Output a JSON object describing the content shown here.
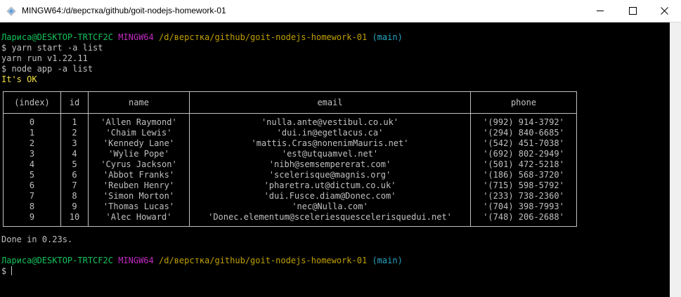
{
  "window": {
    "title": "MINGW64:/d/верстка/github/goit-nodejs-homework-01",
    "controls": {
      "minimize": "minimize",
      "maximize": "maximize",
      "close": "close"
    }
  },
  "prompt": {
    "user": "Лариса@DESKTOP-TRTCF2C",
    "msystem": "MINGW64",
    "path": "/d/верстка/github/goit-nodejs-homework-01",
    "branch": "(main)"
  },
  "output": {
    "line1": "$ yarn start -a list",
    "line2": "yarn run v1.22.11",
    "line3": "$ node app -a list",
    "line4": "It's OK",
    "done": "Done in 0.23s.",
    "final_prompt": "$"
  },
  "table": {
    "headers": [
      "(index)",
      "id",
      "name",
      "email",
      "phone"
    ],
    "rows": [
      [
        "0",
        "1",
        "'Allen Raymond'",
        "'nulla.ante@vestibul.co.uk'",
        "'(992) 914-3792'"
      ],
      [
        "1",
        "2",
        "'Chaim Lewis'",
        "'dui.in@egetlacus.ca'",
        "'(294) 840-6685'"
      ],
      [
        "2",
        "3",
        "'Kennedy Lane'",
        "'mattis.Cras@nonenimMauris.net'",
        "'(542) 451-7038'"
      ],
      [
        "3",
        "4",
        "'Wylie Pope'",
        "'est@utquamvel.net'",
        "'(692) 802-2949'"
      ],
      [
        "4",
        "5",
        "'Cyrus Jackson'",
        "'nibh@semsempererat.com'",
        "'(501) 472-5218'"
      ],
      [
        "5",
        "6",
        "'Abbot Franks'",
        "'scelerisque@magnis.org'",
        "'(186) 568-3720'"
      ],
      [
        "6",
        "7",
        "'Reuben Henry'",
        "'pharetra.ut@dictum.co.uk'",
        "'(715) 598-5792'"
      ],
      [
        "7",
        "8",
        "'Simon Morton'",
        "'dui.Fusce.diam@Donec.com'",
        "'(233) 738-2360'"
      ],
      [
        "8",
        "9",
        "'Thomas Lucas'",
        "'nec@Nulla.com'",
        "'(704) 398-7993'"
      ],
      [
        "9",
        "10",
        "'Alec Howard'",
        "'Donec.elementum@sceleriesquescelerisquedui.net'",
        "'(748) 206-2688'"
      ]
    ]
  }
}
